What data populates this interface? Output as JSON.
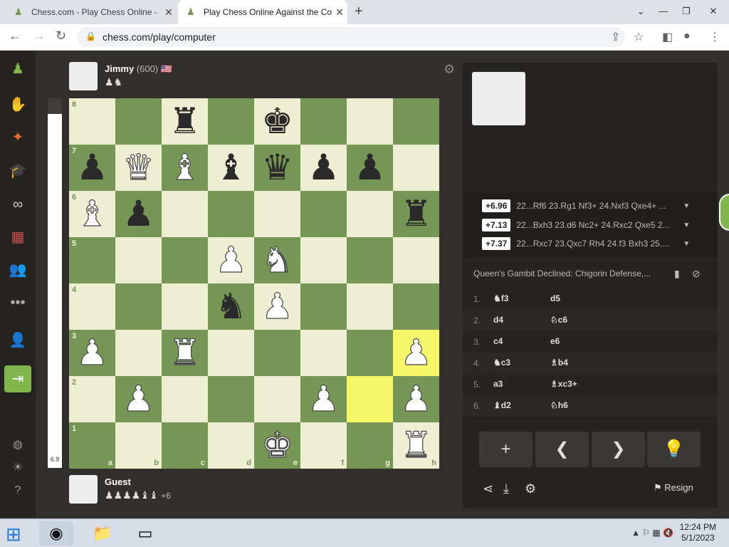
{
  "browser": {
    "tabs": [
      {
        "title": "Chess.com - Play Chess Online -",
        "active": false
      },
      {
        "title": "Play Chess Online Against the Co",
        "active": true
      }
    ],
    "url": "chess.com/play/computer"
  },
  "opponent": {
    "name": "Jimmy",
    "rating": "(600)",
    "flag": "🇺🇸",
    "captured": "♟♞"
  },
  "player": {
    "name": "Guest",
    "captured": "♟♟♟♟♝♝",
    "advantage": "+6"
  },
  "eval_value": "6.9",
  "board": {
    "files": [
      "a",
      "b",
      "c",
      "d",
      "e",
      "f",
      "g",
      "h"
    ],
    "ranks": [
      "8",
      "7",
      "6",
      "5",
      "4",
      "3",
      "2",
      "1"
    ],
    "highlight": [
      "h3",
      "g2"
    ],
    "pieces": {
      "c8": "♜b",
      "e8": "♚b",
      "a7": "♟b",
      "b7": "♛w",
      "c7": "♝w",
      "d7": "♝b",
      "e7": "♛b",
      "f7": "♟b",
      "g7": "♟b",
      "a6": "♝w",
      "b6": "♟b",
      "h6": "♜b",
      "d5": "♟w",
      "e5": "♞w",
      "d4": "♞b",
      "e4": "♟w",
      "a3": "♟w",
      "c3": "♜w",
      "h3": "♟w",
      "b2": "♟w",
      "f2": "♟w",
      "h2": "♟w",
      "e1": "♚w",
      "h1": "♜w"
    }
  },
  "analysis": {
    "lines": [
      {
        "eval": "+6.96",
        "text": "22...Rf6 23.Rg1 Nf3+ 24.Nxf3 Qxe4+ ..."
      },
      {
        "eval": "+7.13",
        "text": "22...Bxh3 23.d6 Nc2+ 24.Rxc2 Qxe5 2..."
      },
      {
        "eval": "+7.37",
        "text": "22...Rxc7 23.Qxc7 Rh4 24.f3 Bxh3 25...."
      }
    ],
    "opening": "Queen's Gambit Declined: Chigorin Defense,...",
    "moves": [
      {
        "n": "1.",
        "w": "♞f3",
        "b": "d5"
      },
      {
        "n": "2.",
        "w": "d4",
        "b": "♘c6"
      },
      {
        "n": "3.",
        "w": "c4",
        "b": "e6"
      },
      {
        "n": "4.",
        "w": "♞c3",
        "b": "♗b4"
      },
      {
        "n": "5.",
        "w": "a3",
        "b": "♗xc3+"
      },
      {
        "n": "6.",
        "w": "♝d2",
        "b": "♘h6"
      }
    ]
  },
  "controls": {
    "add": "+",
    "prev": "❮",
    "next": "❯",
    "hint": "💡",
    "resign": "Resign"
  },
  "taskbar": {
    "time": "12:24 PM",
    "date": "5/1/2023"
  }
}
